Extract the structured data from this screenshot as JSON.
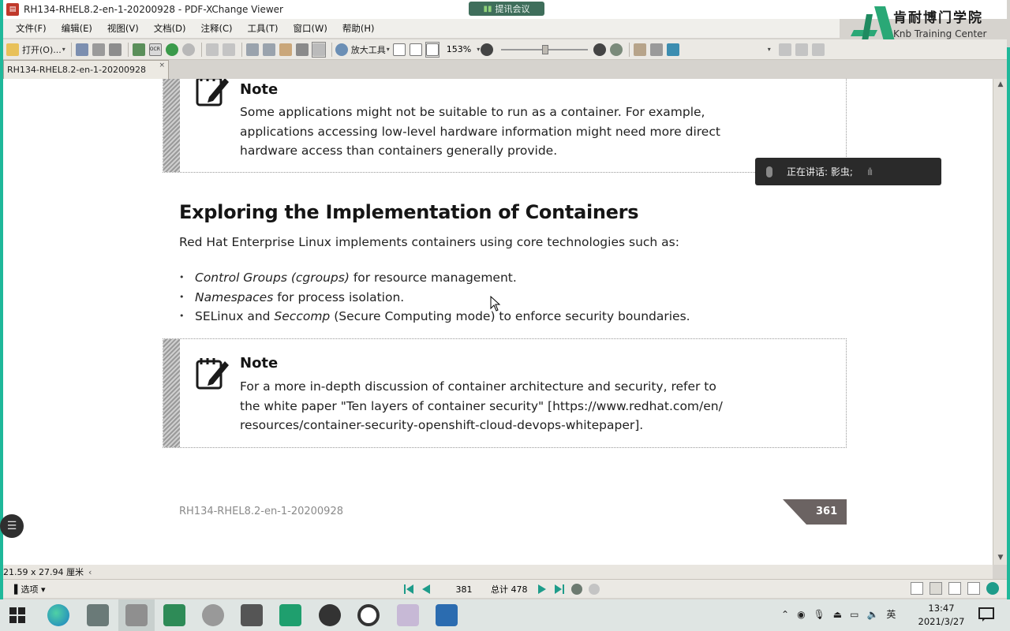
{
  "window": {
    "title": "RH134-RHEL8.2-en-1-20200928 - PDF-XChange Viewer",
    "meeting_badge": "提讯会议"
  },
  "logo": {
    "cn": "肯耐博门学院",
    "en": "Knb Training Center"
  },
  "menu": [
    "文件(F)",
    "编辑(E)",
    "视图(V)",
    "文档(D)",
    "注释(C)",
    "工具(T)",
    "窗口(W)",
    "帮助(H)"
  ],
  "toolbar": {
    "open_label": "打开(O)...",
    "zoom_tool_label": "放大工具",
    "zoom_level": "153%"
  },
  "doc_tab": {
    "label": "RH134-RHEL8.2-en-1-20200928",
    "close": "×"
  },
  "document": {
    "note1": {
      "title": "Note",
      "lines": [
        "Some applications might not be suitable to run as a container. For example,",
        "applications accessing low-level hardware information might need more direct",
        "hardware access than containers generally provide."
      ]
    },
    "heading": "Exploring the Implementation of Containers",
    "intro": "Red Hat Enterprise Linux implements containers using core technologies such as:",
    "bullets": [
      {
        "em": "Control Groups (cgroups)",
        "rest": " for resource management."
      },
      {
        "em": "Namespaces",
        "rest": " for process isolation."
      },
      {
        "pre": "SELinux and ",
        "em": "Seccomp",
        "rest": " (Secure Computing mode) to enforce security boundaries."
      }
    ],
    "note2": {
      "title": "Note",
      "lines": [
        "For a more in-depth discussion of container architecture and security, refer to",
        "the white paper \"Ten layers of container security\" [https://www.redhat.com/en/",
        "resources/container-security-openshift-cloud-devops-whitepaper]."
      ]
    },
    "footer_title": "RH134-RHEL8.2-en-1-20200928",
    "page_number": "361"
  },
  "speaking_overlay": {
    "text": "正在讲话: 影虫;"
  },
  "status": {
    "page_dims": "21.59 x 27.94 厘米",
    "options_label": "选项",
    "current_page": "381",
    "total_pages": "总计 478"
  },
  "taskbar": {
    "ime": "英",
    "time": "13:47",
    "date": "2021/3/27"
  },
  "colors": {
    "accent_green": "#1fb89a",
    "page_tab": "#6b6362",
    "meeting_bg": "#3f6e5b"
  }
}
